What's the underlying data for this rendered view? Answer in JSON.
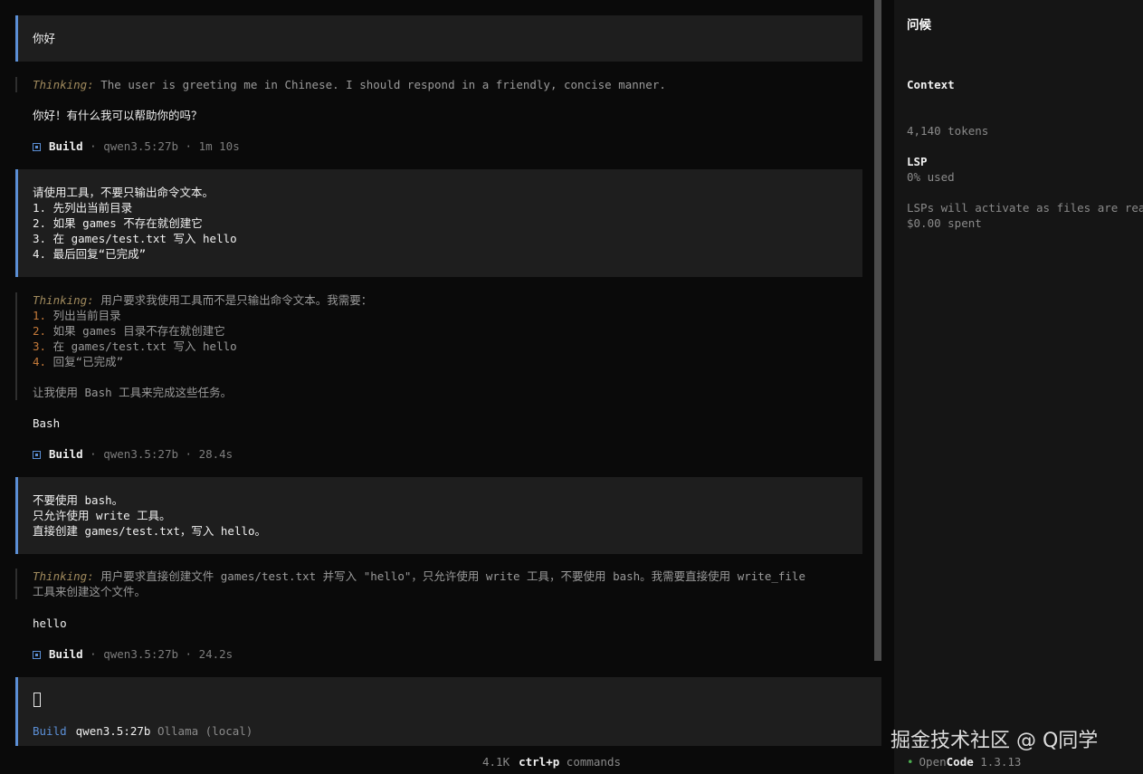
{
  "messages": {
    "user1": {
      "text": "你好"
    },
    "assistant1": {
      "thinking_label": "Thinking:",
      "thinking_text": " The user is greeting me in Chinese. I should respond in a friendly, concise manner.",
      "answer": "你好！有什么我可以帮助你的吗？",
      "agent": "Build",
      "details": " · qwen3.5:27b · 1m 10s"
    },
    "user2": {
      "lines": [
        "请使用工具，不要只输出命令文本。",
        "1. 先列出当前目录",
        "2. 如果 games 不存在就创建它",
        "3. 在 games/test.txt 写入 hello",
        "4. 最后回复“已完成”"
      ]
    },
    "assistant2": {
      "thinking_label": "Thinking:",
      "thinking_first": " 用户要求我使用工具而不是只输出命令文本。我需要：",
      "thinking_list": [
        {
          "num": "1.",
          "text": " 列出当前目录"
        },
        {
          "num": "2.",
          "text": " 如果 games 目录不存在就创建它"
        },
        {
          "num": "3.",
          "text": " 在 games/test.txt 写入 hello"
        },
        {
          "num": "4.",
          "text": " 回复“已完成”"
        }
      ],
      "thinking_after": "让我使用 Bash 工具来完成这些任务。",
      "answer": "Bash",
      "agent": "Build",
      "details": " · qwen3.5:27b · 28.4s"
    },
    "user3": {
      "lines": [
        "不要使用 bash。",
        "只允许使用 write 工具。",
        "直接创建 games/test.txt，写入 hello。"
      ]
    },
    "assistant3": {
      "thinking_label": "Thinking:",
      "thinking_line1": " 用户要求直接创建文件 games/test.txt 并写入 \"hello\"，只允许使用 write 工具，不要使用 bash。我需要直接使用 write_file",
      "thinking_line2": "工具来创建这个文件。",
      "answer": "hello",
      "agent": "Build",
      "details": " · qwen3.5:27b · 24.2s"
    }
  },
  "input": {
    "agent": "Build",
    "model": "qwen3.5:27b",
    "provider": " Ollama (local)"
  },
  "footer": {
    "tokens": "4.1K",
    "shortcut": "ctrl+p",
    "shortcut_label": " commands"
  },
  "sidebar": {
    "title": "问候",
    "context_header": "Context",
    "context_tokens": "4,140 tokens",
    "context_used": "0% used",
    "context_spent": "$0.00 spent",
    "lsp_header": "LSP",
    "lsp_text": "LSPs will activate as files are read",
    "app_open": "Open",
    "app_code": "Code",
    "app_version": " 1.3.13"
  },
  "watermark": "掘金技术社区 @ Q同学",
  "colors": {
    "accent": "#5b8fd6",
    "thinking_label": "#a08a5d",
    "list_number": "#c57a3a",
    "status_dot": "#4caf50"
  }
}
